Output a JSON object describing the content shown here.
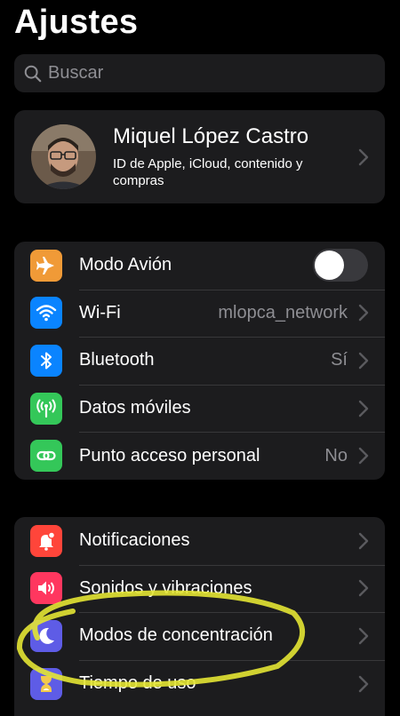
{
  "header": {
    "title": "Ajustes"
  },
  "search": {
    "placeholder": "Buscar"
  },
  "profile": {
    "name": "Miquel López Castro",
    "subtitle": "ID de Apple, iCloud, contenido y compras"
  },
  "group1": {
    "items": [
      {
        "label": "Modo Avión",
        "value": "",
        "toggle_on": false,
        "icon": "airplane-icon",
        "color": "#f09a37"
      },
      {
        "label": "Wi-Fi",
        "value": "mlopca_network",
        "icon": "wifi-icon",
        "color": "#0a84ff"
      },
      {
        "label": "Bluetooth",
        "value": "Sí",
        "icon": "bluetooth-icon",
        "color": "#0a84ff"
      },
      {
        "label": "Datos móviles",
        "value": "",
        "icon": "antenna-icon",
        "color": "#34c759"
      },
      {
        "label": "Punto acceso personal",
        "value": "No",
        "icon": "hotspot-icon",
        "color": "#34c759"
      }
    ]
  },
  "group2": {
    "items": [
      {
        "label": "Notificaciones",
        "icon": "bell-icon",
        "color": "#ff453a"
      },
      {
        "label": "Sonidos y vibraciones",
        "icon": "speaker-icon",
        "color": "#ff375f"
      },
      {
        "label": "Modos de concentración",
        "icon": "moon-icon",
        "color": "#5e5ce6"
      },
      {
        "label": "Tiempo de uso",
        "icon": "hourglass-icon",
        "color": "#5e5ce6"
      }
    ]
  },
  "annotation": {
    "color": "#e4e633"
  }
}
